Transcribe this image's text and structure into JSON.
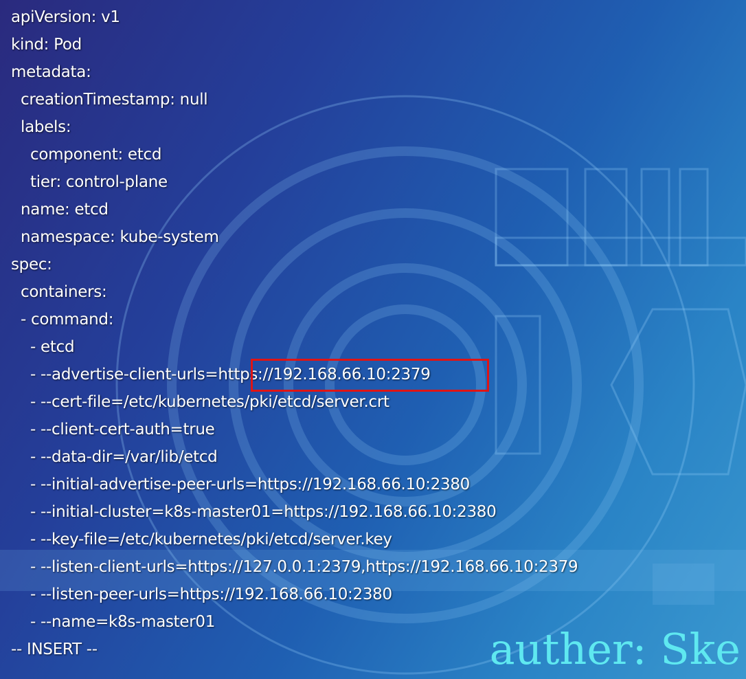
{
  "editor": {
    "lines": [
      "apiVersion: v1",
      "kind: Pod",
      "metadata:",
      "  creationTimestamp: null",
      "  labels:",
      "    component: etcd",
      "    tier: control-plane",
      "  name: etcd",
      "  namespace: kube-system",
      "spec:",
      "  containers:",
      "  - command:",
      "    - etcd",
      "    - --advertise-client-urls=https://192.168.66.10:2379",
      "    - --cert-file=/etc/kubernetes/pki/etcd/server.crt",
      "    - --client-cert-auth=true",
      "    - --data-dir=/var/lib/etcd",
      "    - --initial-advertise-peer-urls=https://192.168.66.10:2380",
      "    - --initial-cluster=k8s-master01=https://192.168.66.10:2380",
      "    - --key-file=/etc/kubernetes/pki/etcd/server.key",
      "    - --listen-client-urls=https://127.0.0.1:2379,https://192.168.66.10:2379",
      "    - --listen-peer-urls=https://192.168.66.10:2380",
      "    - --name=k8s-master01"
    ],
    "status_line": "-- INSERT --"
  },
  "watermark": "auther: Ske",
  "colors": {
    "text": "#ffffff",
    "highlight_border": "#e01414",
    "watermark": "#5fe8f0"
  }
}
